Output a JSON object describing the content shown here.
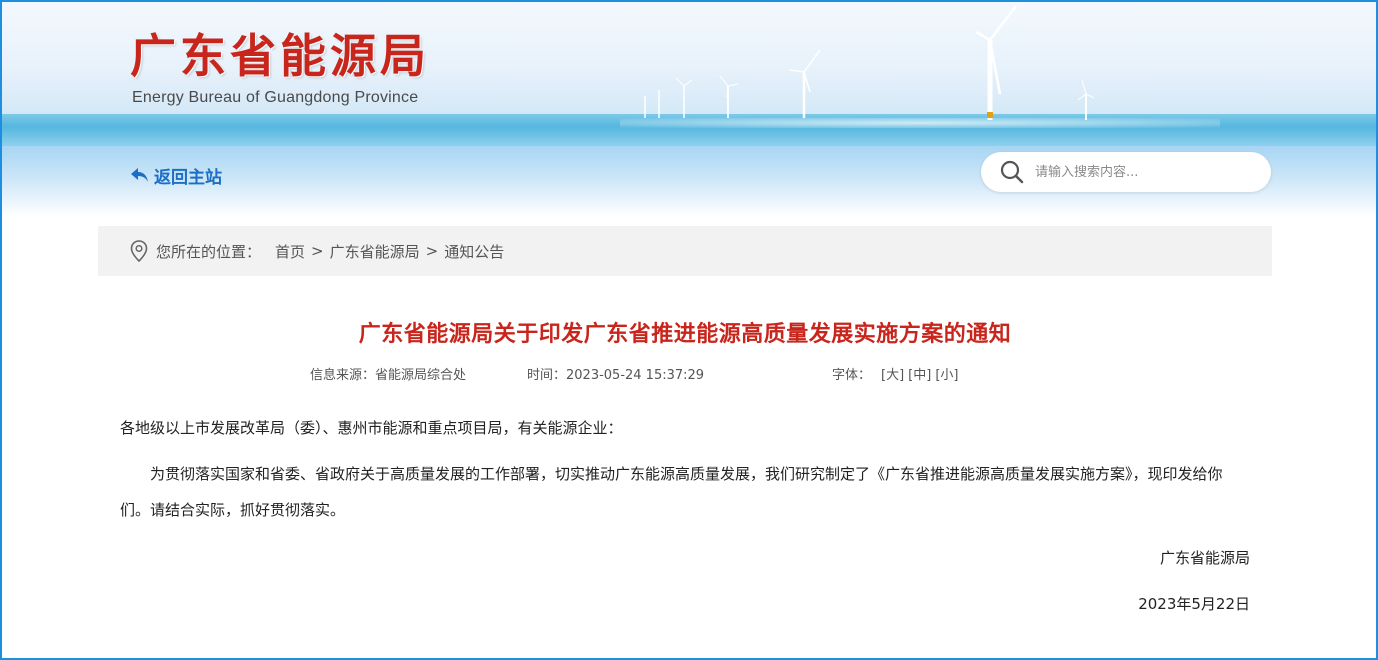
{
  "header": {
    "title": "广东省能源局",
    "subtitle": "Energy Bureau of Guangdong Province"
  },
  "nav": {
    "back_label": "返回主站",
    "search_placeholder": "请输入搜索内容..."
  },
  "breadcrumb": {
    "label": "您所在的位置：",
    "items": [
      "首页",
      "广东省能源局",
      "通知公告"
    ],
    "separator": ">"
  },
  "article": {
    "title": "广东省能源局关于印发广东省推进能源高质量发展实施方案的通知",
    "source": "信息来源：省能源局综合处",
    "time": "时间：2023-05-24 15:37:29",
    "font_size_label": "字体：",
    "font_sizes": [
      "[大]",
      "[中]",
      "[小]"
    ],
    "greeting": "各地级以上市发展改革局（委）、惠州市能源和重点项目局，有关能源企业：",
    "body": "为贯彻落实国家和省委、省政府关于高质量发展的工作部署，切实推动广东能源高质量发展，我们研究制定了《广东省推进能源高质量发展实施方案》，现印发给你们。请结合实际，抓好贯彻落实。",
    "signature": "广东省能源局",
    "date": "2023年5月22日"
  },
  "colors": {
    "title_red": "#c8261c",
    "link_blue": "#1c6fc4",
    "frame_blue": "#1e8fe0"
  },
  "icons": [
    "back-arrow-icon",
    "search-icon",
    "location-pin-icon"
  ]
}
